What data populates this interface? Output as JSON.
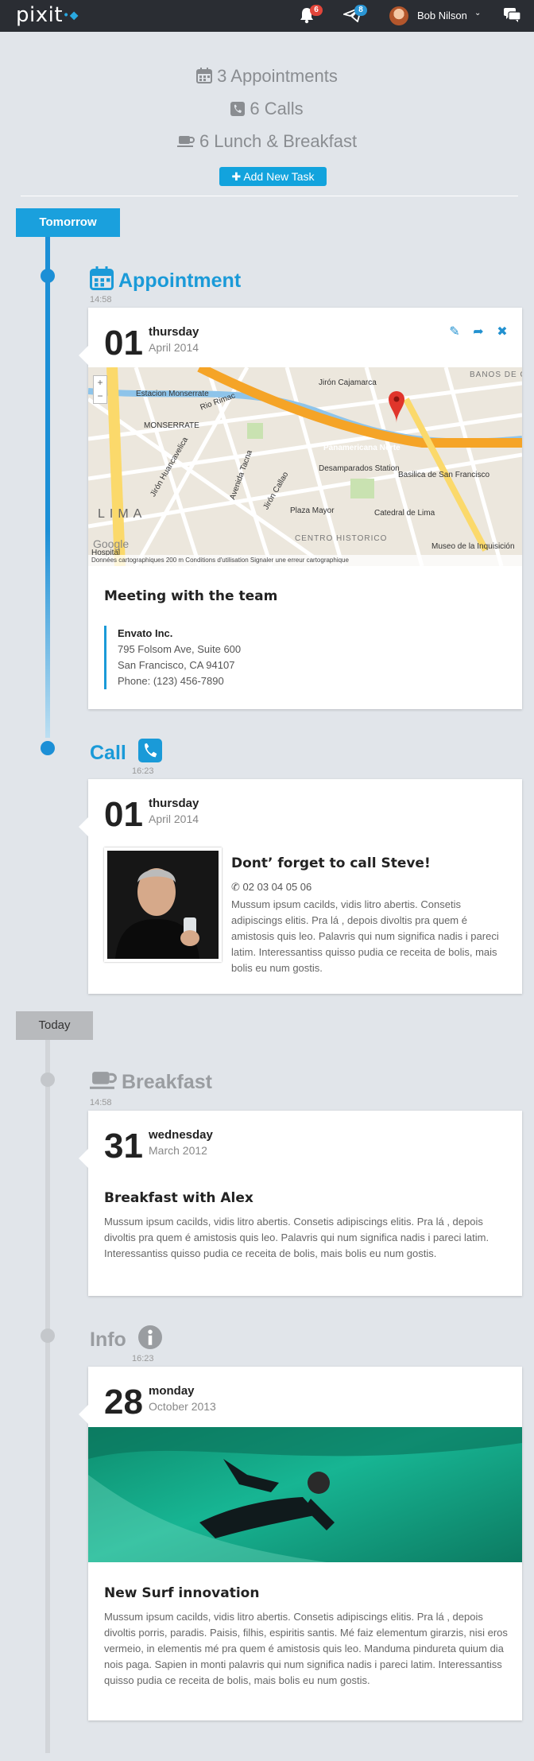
{
  "topbar": {
    "logo": "pixit",
    "notifications_count": "6",
    "messages_count": "8",
    "user_name": "Bob Nilson",
    "icons": [
      "bell-icon",
      "paper-plane-icon",
      "chevron-down-icon",
      "chat-icon"
    ]
  },
  "summary": {
    "appointments": "3 Appointments",
    "calls": "6 Calls",
    "lunch": "6 Lunch & Breakfast",
    "add_task": "Add New Task"
  },
  "sections": {
    "tomorrow": "Tomorrow",
    "today": "Today"
  },
  "events": [
    {
      "type": "Appointment",
      "icon": "calendar-icon",
      "time": "14:58",
      "day": "01",
      "weekday": "thursday",
      "month": "April 2014",
      "title": "Meeting with the team",
      "company": "Envato Inc.",
      "address1": "795 Folsom Ave, Suite 600",
      "address2": "San Francisco, CA 94107",
      "phone": "Phone: (123) 456-7890",
      "map": {
        "labels": [
          "Estacion Monserrate",
          "MONSERRATE",
          "LIMA",
          "Panamericana Norte",
          "Desamparados Station",
          "Basilica de San Francisco",
          "Plaza Mayor",
          "Catedral de Lima",
          "CENTRO HISTORICO",
          "Museo de la Inquisición",
          "Jirón Cajamarca",
          "BANOS DE OTERO",
          "Avenida Tacna",
          "Jirón Callao",
          "Jirón Huancavelica",
          "Rio Rimac",
          "Hospital",
          "Google"
        ],
        "credits": "Données cartographiques   200 m   Conditions d'utilisation   Signaler une erreur cartographique"
      }
    },
    {
      "type": "Call",
      "icon": "phone-icon",
      "time": "16:23",
      "day": "01",
      "weekday": "thursday",
      "month": "April 2014",
      "title": "Dont’ forget to call Steve!",
      "phone": "02 03 04 05 06",
      "body": "Mussum ipsum cacilds, vidis litro abertis. Consetis adipiscings elitis. Pra lá , depois divoltis pra quem é amistosis quis leo. Palavris qui num significa nadis i pareci latim. Interessantiss quisso pudia ce receita de bolis, mais bolis eu num gostis."
    },
    {
      "type": "Breakfast",
      "icon": "coffee-icon",
      "time": "14:58",
      "day": "31",
      "weekday": "wednesday",
      "month": "March 2012",
      "title": "Breakfast with Alex",
      "body": "Mussum ipsum cacilds, vidis litro abertis. Consetis adipiscings elitis. Pra lá , depois divoltis pra quem é amistosis quis leo. Palavris qui num significa nadis i pareci latim. Interessantiss quisso pudia ce receita de bolis, mais bolis eu num gostis."
    },
    {
      "type": "Info",
      "icon": "info-icon",
      "time": "16:23",
      "day": "28",
      "weekday": "monday",
      "month": "October 2013",
      "title": "New Surf innovation",
      "body": "Mussum ipsum cacilds, vidis litro abertis. Consetis adipiscings elitis. Pra lá , depois divoltis porris, paradis. Paisis, filhis, espiritis santis. Mé faiz elementum girarzis, nisi eros vermeio, in elementis mé pra quem é amistosis quis leo. Manduma pindureta quium dia nois paga. Sapien in monti palavris qui num significa nadis i pareci latim. Interessantiss quisso pudia ce receita de bolis, mais bolis eu num gostis."
    }
  ],
  "colors": {
    "accent": "#1a9ad8",
    "topbar": "#2a2d33",
    "background": "#e1e5ea",
    "muted": "#9a9da1"
  }
}
